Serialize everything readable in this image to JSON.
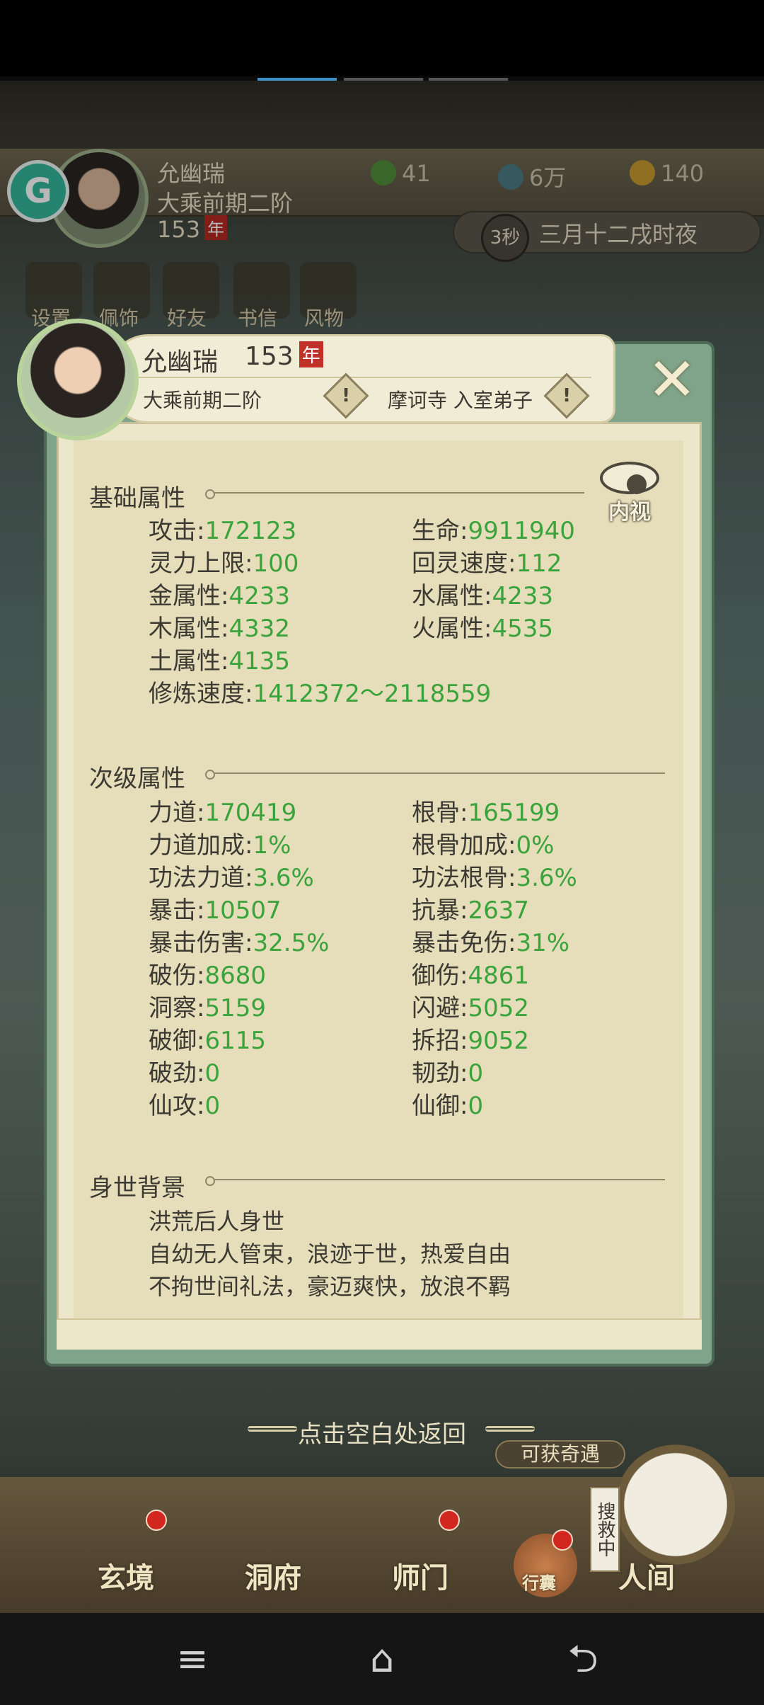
{
  "header": {
    "name": "允幽瑞",
    "realm": "大乘前期二阶",
    "age": "153",
    "age_unit": "年",
    "resources": [
      {
        "icon": "leaf-icon",
        "value": "41"
      },
      {
        "icon": "coin-icon",
        "value": "6万"
      },
      {
        "icon": "gold-ingot-icon",
        "value": "140"
      }
    ],
    "timer": "3秒",
    "game_time": "三月十二戌时夜",
    "quick_menu": [
      "设置",
      "佩饰",
      "好友",
      "书信",
      "风物"
    ],
    "floating_icon": "G"
  },
  "dialog": {
    "name": "允幽瑞",
    "age": "153",
    "age_unit": "年",
    "realm": "大乘前期二阶",
    "sect": "摩诃寺 入室弟子",
    "alert_glyph": "!",
    "close_glyph": "✕",
    "inner_view_label": "内视",
    "basic": {
      "title": "基础属性",
      "stats": [
        {
          "label": "攻击:",
          "value": "172123"
        },
        {
          "label": "生命:",
          "value": "9911940"
        },
        {
          "label": "灵力上限:",
          "value": "100"
        },
        {
          "label": "回灵速度:",
          "value": "112"
        },
        {
          "label": "金属性:",
          "value": "4233"
        },
        {
          "label": "水属性:",
          "value": "4233"
        },
        {
          "label": "木属性:",
          "value": "4332"
        },
        {
          "label": "火属性:",
          "value": "4535"
        },
        {
          "label": "土属性:",
          "value": "4135"
        },
        {
          "label": "修炼速度:",
          "value": "1412372～2118559"
        }
      ]
    },
    "secondary": {
      "title": "次级属性",
      "stats": [
        {
          "label": "力道:",
          "value": "170419"
        },
        {
          "label": "根骨:",
          "value": "165199"
        },
        {
          "label": "力道加成:",
          "value": "1%"
        },
        {
          "label": "根骨加成:",
          "value": "0%"
        },
        {
          "label": "功法力道:",
          "value": "3.6%"
        },
        {
          "label": "功法根骨:",
          "value": "3.6%"
        },
        {
          "label": "暴击:",
          "value": "10507"
        },
        {
          "label": "抗暴:",
          "value": "2637"
        },
        {
          "label": "暴击伤害:",
          "value": "32.5%"
        },
        {
          "label": "暴击免伤:",
          "value": "31%"
        },
        {
          "label": "破伤:",
          "value": "8680"
        },
        {
          "label": "御伤:",
          "value": "4861"
        },
        {
          "label": "洞察:",
          "value": "5159"
        },
        {
          "label": "闪避:",
          "value": "5052"
        },
        {
          "label": "破御:",
          "value": "6115"
        },
        {
          "label": "拆招:",
          "value": "9052"
        },
        {
          "label": "破劲:",
          "value": "0"
        },
        {
          "label": "韧劲:",
          "value": "0"
        },
        {
          "label": "仙攻:",
          "value": "0"
        },
        {
          "label": "仙御:",
          "value": "0"
        }
      ]
    },
    "background": {
      "title": "身世背景",
      "lines": [
        "洪荒后人身世",
        "自幼无人管束，浪迹于世，热爱自由",
        "不拘世间礼法，豪迈爽快，放浪不羁"
      ]
    }
  },
  "hint": "点击空白处返回",
  "bottom_nav": {
    "items": [
      {
        "label": "玄境",
        "icon": "mystic-realm-icon"
      },
      {
        "label": "洞府",
        "icon": "cave-dwelling-icon"
      },
      {
        "label": "师门",
        "icon": "sect-icon"
      }
    ],
    "bag_label": "行囊",
    "adventure": "可获奇遇",
    "searching": "搜救中",
    "world": "人间"
  },
  "system_nav": {
    "menu": "≡",
    "home": "⌂",
    "back": "⮌"
  }
}
